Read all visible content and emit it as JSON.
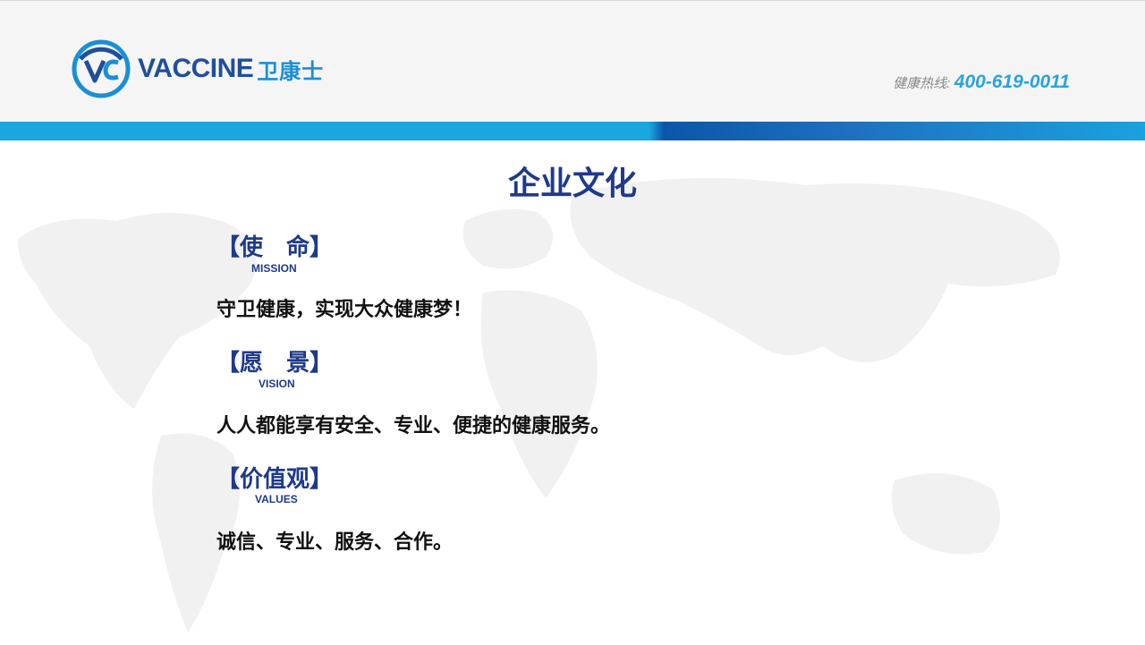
{
  "brand": {
    "name_en": "VACCINE",
    "name_cn": "卫康士",
    "logo_mark": "VC-swirl-logo"
  },
  "hotline": {
    "label": "健康热线:",
    "number": "400-619-0011"
  },
  "title": "企业文化",
  "sections": [
    {
      "heading": "【使　命】",
      "heading_en": "MISSION",
      "body": "守卫健康，实现大众健康梦！"
    },
    {
      "heading": "【愿　景】",
      "heading_en": "VISION",
      "body": "人人都能享有安全、专业、便捷的健康服务。"
    },
    {
      "heading": "【价值观】",
      "heading_en": "VALUES",
      "body": "诚信、专业、服务、合作。"
    }
  ],
  "colors": {
    "brand_blue": "#1f3a8a",
    "accent_cyan": "#2aa3dc",
    "band_light": "#1aa7e0",
    "band_dark": "#0b56a8"
  }
}
